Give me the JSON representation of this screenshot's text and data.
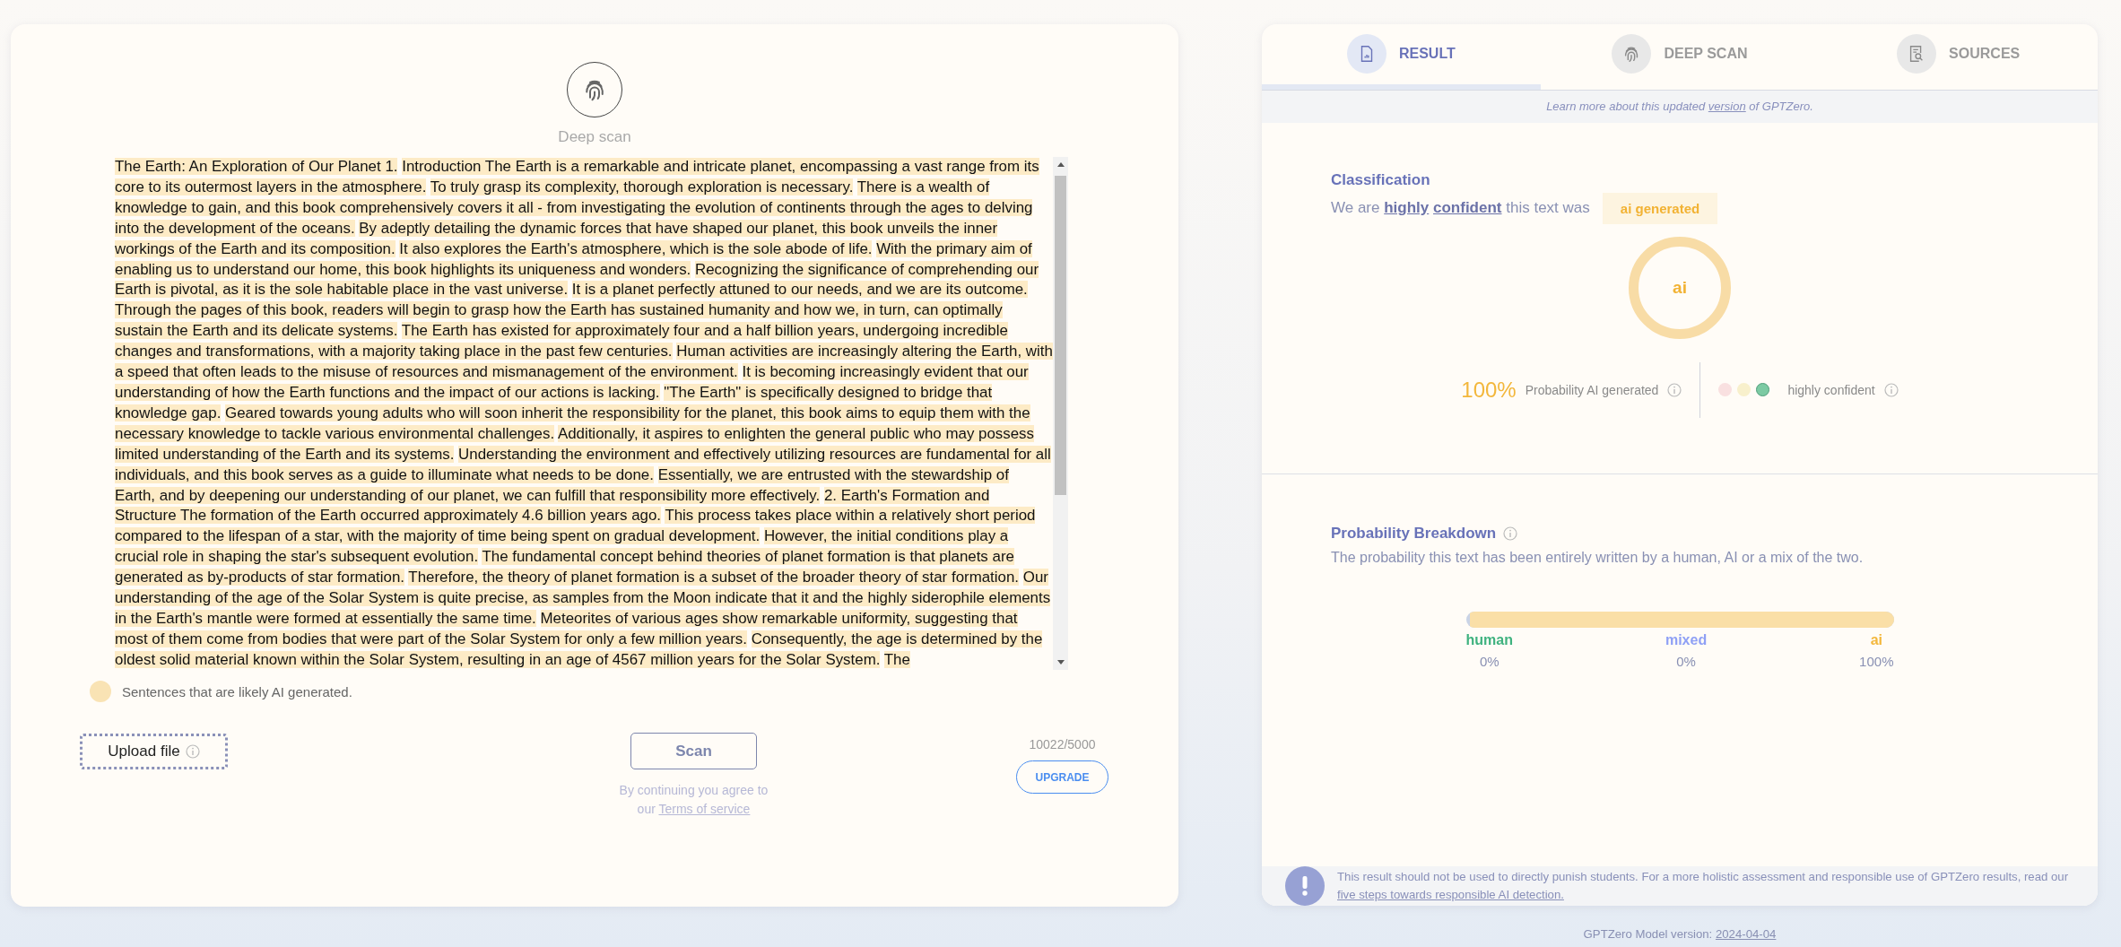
{
  "scan_panel": {
    "deep_scan_label": "Deep scan",
    "sentences": [
      {
        "text": "The Earth: An Exploration of Our Planet 1.",
        "ai_likely": true
      },
      {
        "text": "Introduction The Earth is a remarkable and intricate planet, encompassing a vast range from its core to its outermost layers in the atmosphere.",
        "ai_likely": true
      },
      {
        "text": "To truly grasp its complexity, thorough exploration is necessary.",
        "ai_likely": true
      },
      {
        "text": "There is a wealth of knowledge to gain, and this book comprehensively covers it all - from investigating the evolution of continents through the ages to delving into the development of the oceans.",
        "ai_likely": true
      },
      {
        "text": "By adeptly detailing the dynamic forces that have shaped our planet, this book unveils the inner workings of the Earth and its composition.",
        "ai_likely": true
      },
      {
        "text": "It also explores the Earth's atmosphere, which is the sole abode of life.",
        "ai_likely": true
      },
      {
        "text": "With the primary aim of enabling us to understand our home, this book highlights its uniqueness and wonders.",
        "ai_likely": true
      },
      {
        "text": "Recognizing the significance of comprehending our Earth is pivotal, as it is the sole habitable place in the vast universe.",
        "ai_likely": true
      },
      {
        "text": "It is a planet perfectly attuned to our needs, and we are its outcome.",
        "ai_likely": true
      },
      {
        "text": "Through the pages of this book, readers will begin to grasp how the Earth has sustained humanity and how we, in turn, can optimally sustain the Earth and its delicate systems.",
        "ai_likely": true
      },
      {
        "text": "The Earth has existed for approximately four and a half billion years, undergoing incredible changes and transformations, with a majority taking place in the past few centuries.",
        "ai_likely": true
      },
      {
        "text": "Human activities are increasingly altering the Earth, with a speed that often leads to the misuse of resources and mismanagement of the environment.",
        "ai_likely": true
      },
      {
        "text": "It is becoming increasingly evident that our understanding of how the Earth functions and the impact of our actions is lacking.",
        "ai_likely": true
      },
      {
        "text": "\"The Earth\" is specifically designed to bridge that knowledge gap.",
        "ai_likely": true
      },
      {
        "text": "Geared towards young adults who will soon inherit the responsibility for the planet, this book aims to equip them with the necessary knowledge to tackle various environmental challenges.",
        "ai_likely": true
      },
      {
        "text": "Additionally, it aspires to enlighten the general public who may possess limited understanding of the Earth and its systems.",
        "ai_likely": true
      },
      {
        "text": "Understanding the environment and effectively utilizing resources are fundamental for all individuals, and this book serves as a guide to illuminate what needs to be done.",
        "ai_likely": true
      },
      {
        "text": "Essentially, we are entrusted with the stewardship of Earth, and by deepening our understanding of our planet, we can fulfill that responsibility more effectively.",
        "ai_likely": true
      },
      {
        "text": "2. Earth's Formation and Structure The formation of the Earth occurred approximately 4.6 billion years ago.",
        "ai_likely": true
      },
      {
        "text": "This process takes place within a relatively short period compared to the lifespan of a star, with the majority of time being spent on gradual development.",
        "ai_likely": true
      },
      {
        "text": "However, the initial conditions play a crucial role in shaping the star's subsequent evolution.",
        "ai_likely": true
      },
      {
        "text": "The fundamental concept behind theories of planet formation is that planets are generated as by-products of star formation.",
        "ai_likely": true
      },
      {
        "text": "Therefore, the theory of planet formation is a subset of the broader theory of star formation.",
        "ai_likely": true
      },
      {
        "text": "Our understanding of the age of the Solar System is quite precise, as samples from the Moon indicate that it and the highly siderophile elements in the Earth's mantle were formed at essentially the same time.",
        "ai_likely": true
      },
      {
        "text": "Meteorites of various ages show remarkable uniformity, suggesting that most of them come from bodies that were part of the Solar System for only a few million years.",
        "ai_likely": true
      },
      {
        "text": "Consequently, the age is determined by the oldest solid material known within the Solar System, resulting in an age of 4567 million years for the Solar System.",
        "ai_likely": true
      },
      {
        "text": "The",
        "ai_likely": true
      }
    ],
    "legend": "Sentences that are likely AI generated.",
    "upload_button": "Upload file",
    "scan_button": "Scan",
    "terms": {
      "before": "By continuing you agree to our",
      "link": "Terms of service"
    },
    "word_count": "10022/5000",
    "upgrade_button": "UPGRADE"
  },
  "result_panel": {
    "tabs": [
      {
        "label": "RESULT",
        "selected": true
      },
      {
        "label": "DEEP SCAN",
        "selected": false
      },
      {
        "label": "SOURCES",
        "selected": false
      }
    ],
    "banner": {
      "before": "Learn more about this updated",
      "link": "version",
      "after": "of GPTZero."
    },
    "classification": {
      "title": "Classification",
      "before": "We are",
      "links": [
        "highly",
        "confident"
      ],
      "after": "this text was",
      "badge": "ai generated",
      "donut_label": "ai",
      "probability": "100%",
      "probability_label": "Probability AI generated",
      "confidence_dots": [
        {
          "color": "#f9e0e0",
          "selected": false
        },
        {
          "color": "#f8f0cc",
          "selected": false
        },
        {
          "color": "#7ccaa3",
          "selected": true
        }
      ],
      "confidence_label": "highly confident"
    },
    "breakdown": {
      "title": "Probability Breakdown",
      "description": "The probability this text has been entirely written by a human, AI or a mix of the two.",
      "items": [
        {
          "label": "human",
          "value": "0%",
          "color": "#3fb27f"
        },
        {
          "label": "mixed",
          "value": "0%",
          "color": "#8fa0f5"
        },
        {
          "label": "ai",
          "value": "100%",
          "level": 1,
          "color": "#f3b73c"
        }
      ]
    },
    "notice": {
      "before": "This result should not be used to directly punish students. For a more holistic assessment and responsible use of GPTZero results, read our",
      "link": "five steps towards responsible AI detection."
    }
  },
  "footer": {
    "before": "GPTZero Model version:",
    "link": "2024-04-04"
  }
}
